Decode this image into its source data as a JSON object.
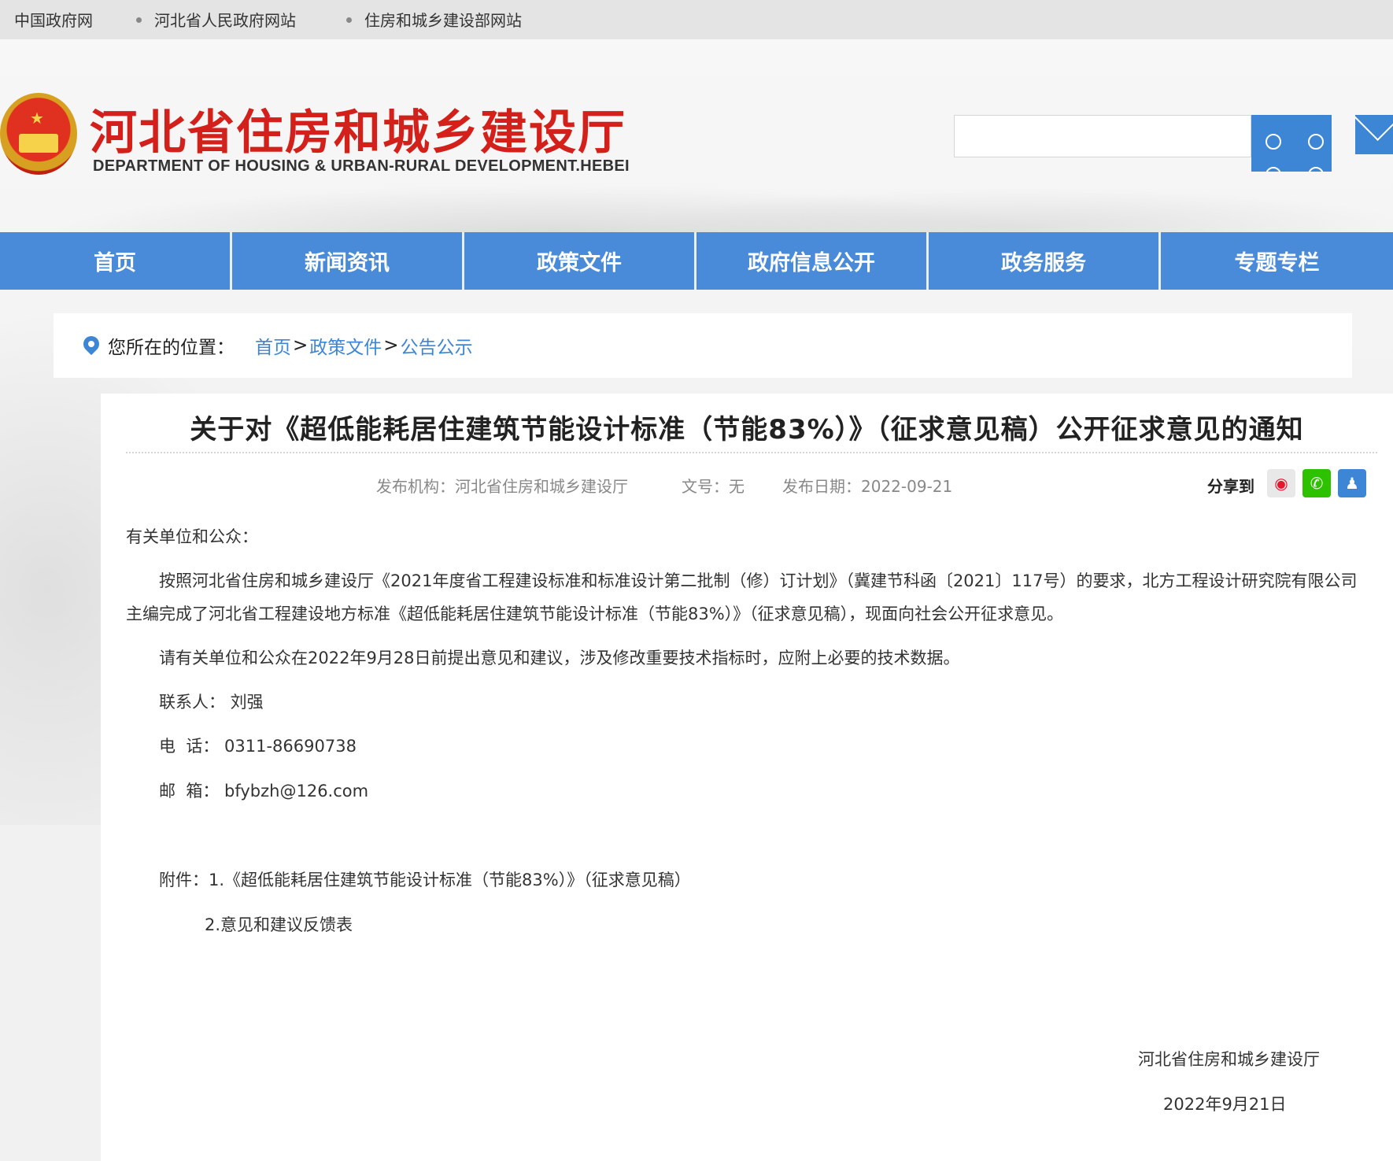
{
  "topbar": {
    "links": [
      "中国政府网",
      "河北省人民政府网站",
      "住房和城乡建设部网站"
    ]
  },
  "header": {
    "title": "河北省住房和城乡建设厅",
    "subtitle": "DEPARTMENT OF HOUSING & URBAN-RURAL DEVELOPMENT.HEBEI",
    "search_placeholder": ""
  },
  "nav": {
    "items": [
      "首页",
      "新闻资讯",
      "政策文件",
      "政府信息公开",
      "政务服务",
      "专题专栏"
    ]
  },
  "breadcrumb": {
    "label": "您所在的位置：",
    "items": [
      "首页",
      "政策文件",
      "公告公示"
    ],
    "separator": ">"
  },
  "article": {
    "title": "关于对《超低能耗居住建筑节能设计标准（节能83%）》（征求意见稿）公开征求意见的通知",
    "meta": {
      "publisher": "发布机构：河北省住房和城乡建设厅",
      "doc_no": "文号：无",
      "date": "发布日期：2022-09-21"
    },
    "share_label": "分享到",
    "salutation": "有关单位和公众：",
    "para1_line1": "按照河北省住房和城乡建设厅《2021年度省工程建设标准和标准设计第二批制（修）订计划》（冀建节科函〔2021〕117号）的要求，北方工程设计研究院有限公司",
    "para1_line2": "主编完成了河北省工程建设地方标准《超低能耗居住建筑节能设计标准（节能83%）》（征求意见稿），现面向社会公开征求意见。",
    "para2": "请有关单位和公众在2022年9月28日前提出意见和建议，涉及修改重要技术指标时，应附上必要的技术数据。",
    "contact": "联系人： 刘强",
    "phone": "电  话： 0311-86690738",
    "email": "邮  箱： bfybzh@126.com",
    "attachment1": "附件：1.《超低能耗居住建筑节能设计标准（节能83%）》（征求意见稿）",
    "attachment2": "2.意见和建议反馈表",
    "sign_org": "河北省住房和城乡建设厅",
    "sign_date": "2022年9月21日"
  },
  "colors": {
    "nav_bg": "#4a8bd9",
    "title_red": "#d4201a",
    "link_blue": "#3d86d6"
  }
}
